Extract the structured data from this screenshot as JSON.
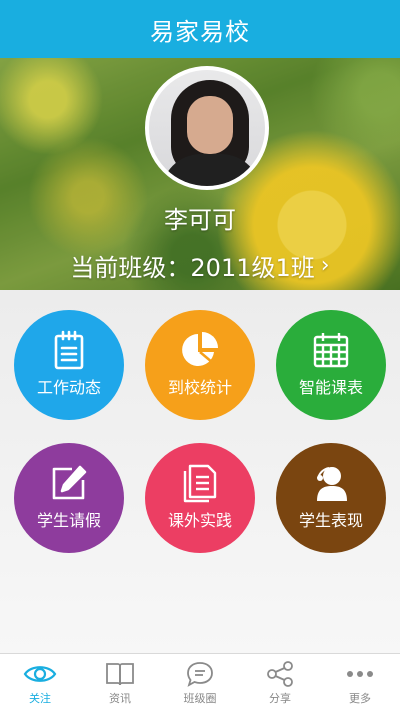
{
  "header": {
    "title": "易家易校"
  },
  "profile": {
    "name": "李可可",
    "class_label": "当前班级：2011级1班"
  },
  "menu": [
    {
      "label": "工作动态",
      "icon": "clipboard-icon",
      "color": "#1fa7ea"
    },
    {
      "label": "到校统计",
      "icon": "pie-chart-icon",
      "color": "#f6a01a"
    },
    {
      "label": "智能课表",
      "icon": "calendar-icon",
      "color": "#2aad3b"
    },
    {
      "label": "学生请假",
      "icon": "edit-icon",
      "color": "#8e3c9d"
    },
    {
      "label": "课外实践",
      "icon": "document-icon",
      "color": "#ec3e63"
    },
    {
      "label": "学生表现",
      "icon": "student-icon",
      "color": "#7a4510"
    }
  ],
  "tabs": [
    {
      "label": "关注",
      "icon": "eye-icon",
      "active": true,
      "color": "#19aee0"
    },
    {
      "label": "资讯",
      "icon": "book-icon",
      "active": false
    },
    {
      "label": "班级圈",
      "icon": "chat-icon",
      "active": false
    },
    {
      "label": "分享",
      "icon": "share-icon",
      "active": false
    },
    {
      "label": "更多",
      "icon": "more-icon",
      "active": false
    }
  ]
}
